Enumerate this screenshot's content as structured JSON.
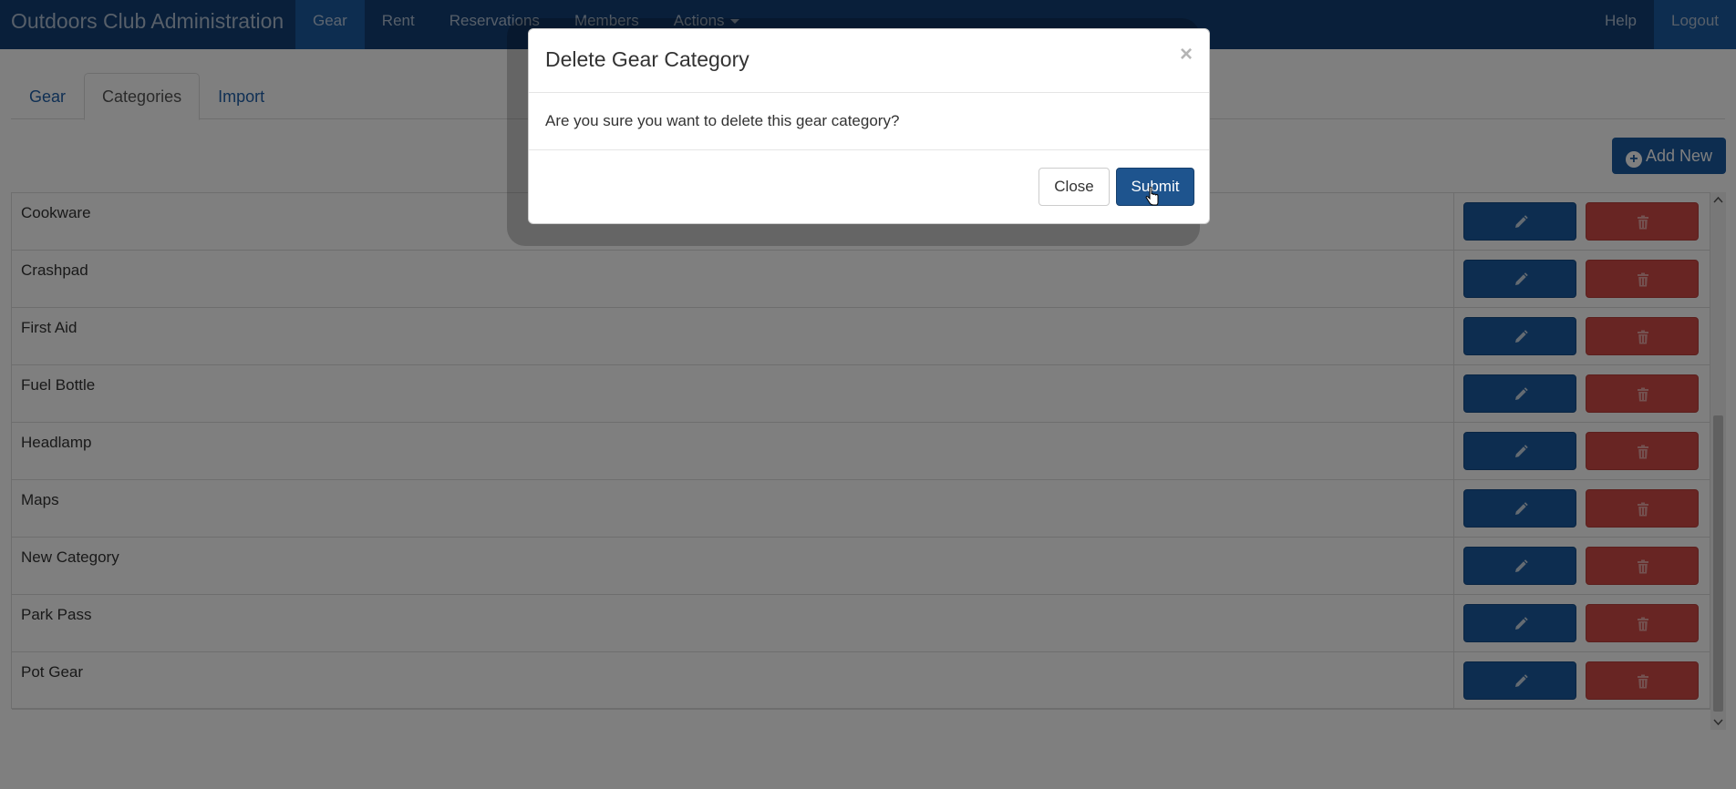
{
  "navbar": {
    "brand": "Outdoors Club Administration",
    "items": [
      {
        "label": "Gear"
      },
      {
        "label": "Rent"
      },
      {
        "label": "Reservations"
      },
      {
        "label": "Members"
      },
      {
        "label": "Actions"
      }
    ],
    "right": [
      {
        "label": "Help"
      },
      {
        "label": "Logout"
      }
    ]
  },
  "tabs": [
    {
      "label": "Gear"
    },
    {
      "label": "Categories"
    },
    {
      "label": "Import"
    }
  ],
  "add_new_label": "Add New",
  "categories": [
    {
      "name": "Cookware"
    },
    {
      "name": "Crashpad"
    },
    {
      "name": "First Aid"
    },
    {
      "name": "Fuel Bottle"
    },
    {
      "name": "Headlamp"
    },
    {
      "name": "Maps"
    },
    {
      "name": "New Category"
    },
    {
      "name": "Park Pass"
    },
    {
      "name": "Pot Gear"
    }
  ],
  "modal": {
    "title": "Delete Gear Category",
    "close_glyph": "×",
    "message": "Are you sure you want to delete this gear category?",
    "close_label": "Close",
    "submit_label": "Submit"
  },
  "colors": {
    "navbar": "#123e74",
    "primary": "#1a5aa0",
    "danger": "#d14b46"
  }
}
